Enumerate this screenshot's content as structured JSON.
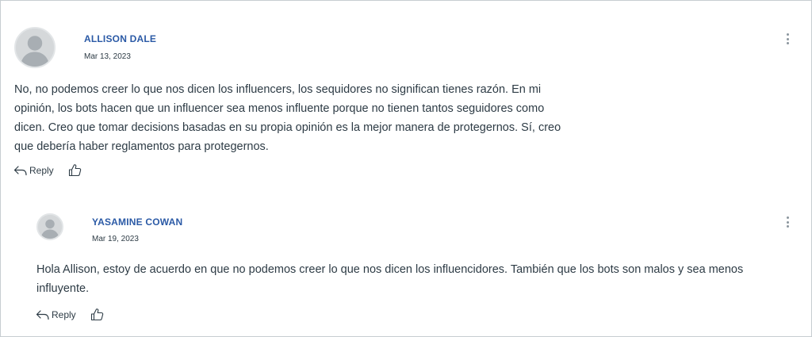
{
  "entries": [
    {
      "author": "ALLISON DALE",
      "date": "Mar 13, 2023",
      "message": "No, no podemos creer lo que nos dicen los influencers, los sequidores no significan tienes razón. En mi opinión, los bots hacen que un influencer sea menos influente porque no tienen tantos seguidores como dicen. Creo que tomar decisions basadas en su propia opinión es la mejor manera de protegernos. Sí, creo que debería haber reglamentos para protegernos.",
      "reply_label": "Reply"
    },
    {
      "author": "YASAMINE COWAN",
      "date": "Mar 19, 2023",
      "message": "Hola Allison, estoy de acuerdo en que no podemos creer lo que nos dicen los influencidores. También que los bots son malos y sea menos influyente.",
      "reply_label": "Reply"
    }
  ],
  "icons": {
    "avatar": "default-user-avatar",
    "menu": "more-vertical-icon",
    "reply": "reply-arrow-icon",
    "like": "thumbs-up-icon"
  },
  "colors": {
    "author_link": "#2b5aa6",
    "text": "#2d3b45",
    "border": "#c7cdd1",
    "avatar_bg": "#d5d8da"
  }
}
